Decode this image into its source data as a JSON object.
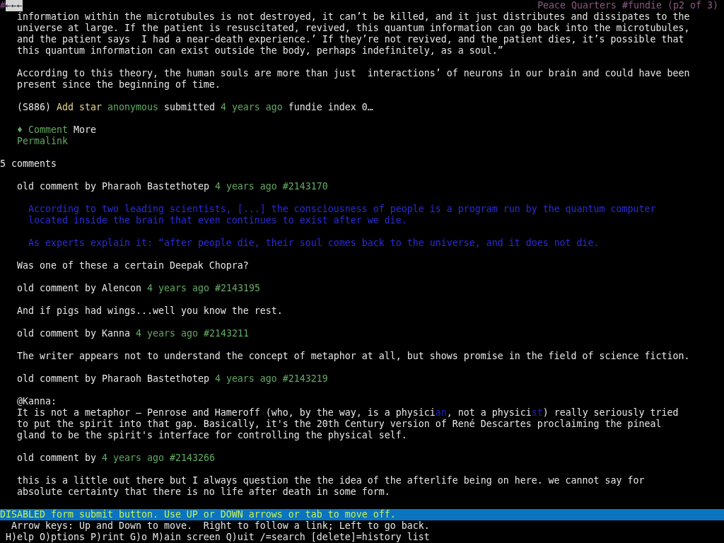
{
  "top_bar": {
    "marker": "#",
    "back_link": "←←←",
    "title": "Peace Quarters #fundie (p2 of 3)"
  },
  "article": {
    "paragraphs": [
      [
        "information within the microtubules is not destroyed, it can’t be killed, and it just distributes and dissipates to the",
        "universe at large. If the patient is resuscitated, revived, this quantum information can go back into the microtubules,",
        "and the patient says  I had a near-death experience.’ If they’re not revived, and the patient dies, it’s possible that",
        "this quantum information can exist outside the body, perhaps indefinitely, as a soul.”"
      ],
      [
        "According to this theory, the human souls are more than just  interactions’ of neurons in our brain and could have been",
        "present since the beginning of time."
      ]
    ]
  },
  "meta": {
    "id": "(S886)",
    "add_star": "Add star",
    "author": "anonymous",
    "submitted": "submitted",
    "age": "4 years ago",
    "tags": "fundie index 0…"
  },
  "actions": {
    "bullet": "♦",
    "comment": "Comment",
    "more": "More",
    "permalink": "Permalink"
  },
  "comments_count": "5 comments",
  "comments": [
    {
      "prefix": "old comment by",
      "author": "Pharaoh Bastethotep",
      "age": "4 years ago",
      "number": "#2143170",
      "quotes": [
        [
          "According to two leading scientists, [...] the consciousness of people is a program run by the quantum computer",
          "located inside the brain that even continues to exist after we die."
        ],
        [
          "As experts explain it: “after people die, their soul comes back to the universe, and it does not die."
        ]
      ],
      "body": [
        "Was one of these a certain Deepak Chopra?"
      ]
    },
    {
      "prefix": "old comment by",
      "author": "Alencon",
      "age": "4 years ago",
      "number": "#2143195",
      "body": [
        "And if pigs had wings...well you know the rest."
      ]
    },
    {
      "prefix": "old comment by",
      "author": "Kanna",
      "age": "4 years ago",
      "number": "#2143211",
      "body": [
        "The writer appears not to understand the concept of metaphor at all, but shows promise in the field of science fiction."
      ]
    },
    {
      "prefix": "old comment by",
      "author": "Pharaoh Bastethotep",
      "age": "4 years ago",
      "number": "#2143219",
      "body": [
        "@Kanna:",
        [
          {
            "text": "It is not a metaphor – Penrose and Hameroff (who, by the way, is a physici",
            "kind": "plain"
          },
          {
            "text": "an",
            "kind": "link"
          },
          {
            "text": ", not a physici",
            "kind": "plain"
          },
          {
            "text": "st",
            "kind": "link"
          },
          {
            "text": ") really seriously tried",
            "kind": "plain"
          }
        ],
        "to put the spirit into that gap. Basically, it's the 20th Century version of René Descartes proclaiming the pineal",
        "gland to be the spirit's interface for controlling the physical self."
      ]
    },
    {
      "prefix": "old comment by",
      "age": "4 years ago",
      "number": "#2143266",
      "body": [
        "this is a little out there but I always question the the idea of the afterlife being on here. we cannot say for",
        "absolute certainty that there is no life after death in some form."
      ]
    }
  ],
  "status": {
    "message": "DISABLED form submit button. Use UP or DOWN arrows or tab to move off."
  },
  "help": [
    "Arrow keys: Up and Down to move.  Right to follow a link; Left to go back.",
    "H)elp O)ptions P)rint G)o M)ain screen Q)uit /=search [delete]=history list"
  ]
}
